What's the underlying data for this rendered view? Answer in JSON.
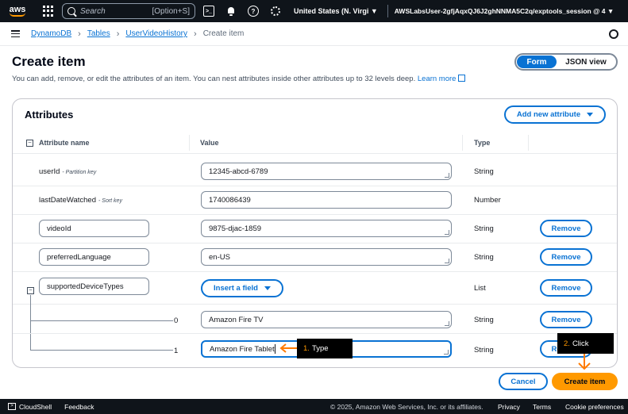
{
  "topnav": {
    "logo_text": "aws",
    "search_placeholder": "Search",
    "search_shortcut": "[Option+S]",
    "region": "United States (N. Virgi ▼",
    "account": "AWSLabsUser-2gfjAqxQJ6J2ghNNMA5C2q/exptools_session @ 4 ▼"
  },
  "breadcrumbs": {
    "items": [
      "DynamoDB",
      "Tables",
      "UserVideoHistory"
    ],
    "current": "Create item"
  },
  "header": {
    "title": "Create item",
    "description": "You can add, remove, or edit the attributes of an item. You can nest attributes inside other attributes up to 32 levels deep.",
    "learn_more": "Learn more",
    "view_toggle": {
      "form": "Form",
      "json": "JSON view",
      "selected": "Form"
    }
  },
  "attributes": {
    "title": "Attributes",
    "add_button": "Add new attribute",
    "columns": {
      "name": "Attribute name",
      "value": "Value",
      "type": "Type"
    },
    "remove_label": "Remove",
    "insert_field_label": "Insert a field",
    "rows": [
      {
        "name": "userId",
        "key_label": "- Partition key",
        "value": "12345-abcd-6789",
        "type": "String"
      },
      {
        "name": "lastDateWatched",
        "key_label": "- Sort key",
        "value": "1740086439",
        "type": "Number"
      },
      {
        "name": "videoId",
        "value": "9875-djac-1859",
        "type": "String"
      },
      {
        "name": "preferredLanguage",
        "value": "en-US",
        "type": "String"
      },
      {
        "name": "supportedDeviceTypes",
        "type": "List"
      }
    ],
    "list_items": [
      {
        "index": "0",
        "value": "Amazon Fire TV",
        "type": "String"
      },
      {
        "index": "1",
        "value": "Amazon Fire Tablet",
        "type": "String"
      }
    ]
  },
  "footer_actions": {
    "cancel": "Cancel",
    "create": "Create item"
  },
  "callouts": {
    "type": {
      "num": "1.",
      "text": "Type"
    },
    "click": {
      "num": "2.",
      "text": "Click"
    }
  },
  "bottombar": {
    "cloudshell": "CloudShell",
    "feedback": "Feedback",
    "copyright": "© 2025, Amazon Web Services, Inc. or its affiliates.",
    "privacy": "Privacy",
    "terms": "Terms",
    "cookies": "Cookie preferences"
  },
  "colors": {
    "accent": "#0972d3",
    "primary_button": "#ff9900",
    "nav_bg": "#0f141a"
  }
}
